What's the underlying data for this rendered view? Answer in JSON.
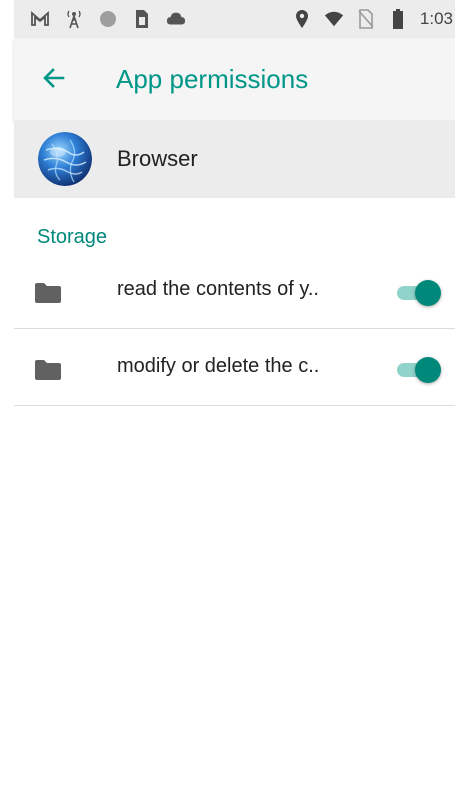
{
  "status_bar": {
    "time": "1:03",
    "left_icons": [
      "gmail-icon",
      "tower-icon",
      "circle-icon",
      "sim-icon",
      "cloud-icon"
    ],
    "right_icons": [
      "location-icon",
      "wifi-icon",
      "no-sim-icon",
      "battery-icon"
    ]
  },
  "app_bar": {
    "title": "App permissions",
    "back_icon": "arrow-back-icon"
  },
  "app": {
    "name": "Browser",
    "icon": "browser-globe-icon"
  },
  "section": {
    "label": "Storage"
  },
  "permissions": [
    {
      "label": "read the contents of y..",
      "icon": "folder-icon",
      "enabled": true
    },
    {
      "label": "modify or delete the c..",
      "icon": "folder-icon",
      "enabled": true
    }
  ],
  "colors": {
    "accent": "#009688",
    "toggle_thumb": "#00897b",
    "toggle_track": "#8fd3cb"
  }
}
